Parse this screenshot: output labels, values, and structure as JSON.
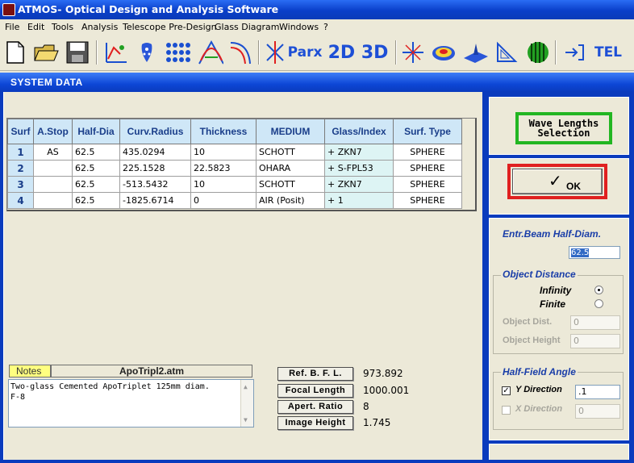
{
  "window": {
    "title": "ATMOS- Optical Design and Analysis Software"
  },
  "menu": [
    "File",
    "Edit",
    "Tools",
    "Analysis",
    "Telescope Pre-Design",
    "Glass Diagram",
    "Windows",
    "?"
  ],
  "toolbar": {
    "parx_label": "Parx",
    "view_label": "2D 3D",
    "tel_label": "TEL",
    "icons": [
      "new-file-icon",
      "open-folder-icon",
      "save-disk-icon",
      "layout-optics-icon",
      "spot-diagram-icon",
      "ray-fan-icon",
      "aberration-icon",
      "curve-icon",
      "lens-chart-icon",
      "parx-icon",
      "2d-3d-view-icon",
      "rays-icon",
      "wavefront-map-icon",
      "psf-3d-icon",
      "ruler-triangle-icon",
      "interferogram-icon",
      "exit-icon",
      "tel-icon"
    ]
  },
  "child_window": {
    "title": "SYSTEM   DATA"
  },
  "table": {
    "headers": [
      "Surf",
      "A.Stop",
      "Half-Dia",
      "Curv.Radius",
      "Thickness",
      "MEDIUM",
      "Glass/Index",
      "Surf. Type"
    ],
    "rows": [
      [
        "1",
        "AS",
        "62.5",
        "435.0294",
        "10",
        "SCHOTT",
        "+ ZKN7",
        "SPHERE"
      ],
      [
        "2",
        "",
        "62.5",
        "225.1528",
        "22.5823",
        "OHARA",
        "+ S-FPL53",
        "SPHERE"
      ],
      [
        "3",
        "",
        "62.5",
        "-513.5432",
        "10",
        "SCHOTT",
        "+ ZKN7",
        "SPHERE"
      ],
      [
        "4",
        "",
        "62.5",
        "-1825.6714",
        "0",
        "AIR (Posit)",
        "+ 1",
        "SPHERE"
      ]
    ]
  },
  "notes": {
    "tab_label": "Notes",
    "file_name": "ApoTripl2.atm",
    "text_line1": "Two-glass Cemented ApoTriplet  125mm diam.",
    "text_line2": "F-8"
  },
  "results": {
    "bfl_label": "Ref.  B. F. L.",
    "bfl_value": "973.892",
    "focal_label": "Focal  Length",
    "focal_value": "1000.001",
    "apert_label": "Apert. Ratio",
    "apert_value": "8",
    "imgh_label": "Image Height",
    "imgh_value": "1.745"
  },
  "right_panel": {
    "wave_button_line1": "Wave Lengths",
    "wave_button_line2": "Selection",
    "ok_label": "OK",
    "entr_beam_label": "Entr.Beam Half-Diam.",
    "entr_beam_value": "62.5",
    "object_distance": {
      "title": "Object  Distance",
      "infinity_label": "Infinity",
      "finite_label": "Finite",
      "dist_label": "Object  Dist.",
      "dist_value": "0",
      "height_label": "Object  Height",
      "height_value": "0",
      "selected": "Infinity"
    },
    "half_field": {
      "title": "Half-Field Angle",
      "y_label": "Y Direction",
      "y_value": ".1",
      "y_checked": true,
      "x_label": "X Direction",
      "x_value": "0",
      "x_checked": false
    }
  },
  "colors": {
    "title_blue": "#0a3bbd",
    "header_cell": "#cfe7f7",
    "header_text": "#1a3e8a",
    "glass_cell": "#ddf4f4",
    "wave_border": "#22b622",
    "ok_border": "#e02020",
    "notes_tab": "#ffff80"
  }
}
